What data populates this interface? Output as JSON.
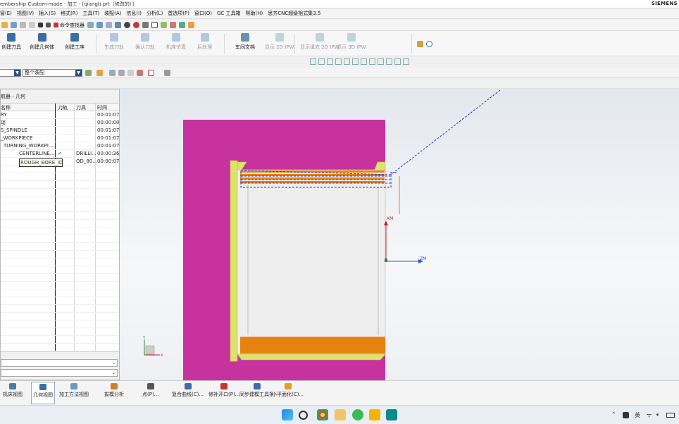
{
  "window": {
    "title": "embership Custom-made - 加工 - [qiangti.prt（修改的）]",
    "brand": "SIEMENS"
  },
  "menu": [
    "窗(E)",
    "视图(V)",
    "插入(S)",
    "格式(R)",
    "工具(T)",
    "装配(A)",
    "信息(I)",
    "分析(L)",
    "首选项(P)",
    "窗口(O)",
    "GC 工具箱",
    "帮助(H)",
    "思齐CNC超级祖式集3.5"
  ],
  "quickbar": {
    "command_finder": "命令查找器"
  },
  "ribbon": [
    {
      "label": "创建刀具",
      "enabled": true,
      "color": "#3a6ea5"
    },
    {
      "label": "创建几何体",
      "enabled": true,
      "color": "#3a6ea5"
    },
    {
      "label": "创建工序",
      "enabled": true,
      "color": "#3a6ea5"
    },
    {
      "label": "生成刀轨",
      "enabled": false,
      "color": "#5b8fc0"
    },
    {
      "label": "确认刀轨",
      "enabled": false,
      "color": "#5b8fc0"
    },
    {
      "label": "机床仿真",
      "enabled": false,
      "color": "#5b8fc0"
    },
    {
      "label": "后处理",
      "enabled": false,
      "color": "#5b8fc0"
    },
    {
      "label": "车间文档",
      "enabled": true,
      "color": "#6a8fb0"
    },
    {
      "label": "显示 2D IPW",
      "enabled": false,
      "color": "#7aa"
    },
    {
      "label": "显示填充 2D IPW",
      "enabled": false,
      "color": "#7aa"
    },
    {
      "label": "显示 3D IPW",
      "enabled": false,
      "color": "#7aa"
    }
  ],
  "selection": {
    "filter_value": "",
    "scope_value": "整个装配"
  },
  "navigator": {
    "title": "航器 - 几何",
    "columns": [
      "名称",
      "刀轨",
      "刀具",
      "时间"
    ],
    "rows": [
      {
        "name": "RY",
        "path": "",
        "tool": "",
        "time": "00:01:07"
      },
      {
        "name": "项",
        "path": "",
        "tool": "",
        "time": "00:00:00"
      },
      {
        "name": "S_SPINDLE",
        "path": "",
        "tool": "",
        "time": "00:01:07"
      },
      {
        "name": "_WORKPIECE",
        "path": "",
        "tool": "",
        "time": "00:01:07"
      },
      {
        "name": "TURNING_WORKPI...",
        "path": "",
        "tool": "",
        "time": "00:01:07"
      },
      {
        "name": "CENTERLINE...",
        "path": "✔",
        "tool": "DRILLI...",
        "time": "00:00:36"
      },
      {
        "name": "ROUGH_BORE_ID",
        "path": "",
        "tool": "OD_80...",
        "time": "00:00:07"
      }
    ],
    "selected_label": "ROUGH_BORE_ID"
  },
  "viewport": {
    "axis_x": "XM",
    "axis_z": "ZM",
    "triad_x": "X",
    "triad_y": "Y"
  },
  "bottombar": [
    {
      "label": "机床视图",
      "active": false
    },
    {
      "label": "几何视图",
      "active": true
    },
    {
      "label": "加工方法视图",
      "active": false
    },
    {
      "label": "拔模分析",
      "active": false
    },
    {
      "label": "点(P)...",
      "active": false
    },
    {
      "label": "复合曲线(C)...",
      "active": false
    },
    {
      "label": "修补开口(P)...",
      "active": false
    },
    {
      "label": "同步建模工具条",
      "active": false
    },
    {
      "label": "小平面化(C)...",
      "active": false
    }
  ],
  "tray": {
    "ime": "英"
  },
  "colors": {
    "stock": "#c8329e",
    "part": "#dde36a",
    "chip": "#e8820f",
    "toolpath": "#2233cc",
    "accent": "#2b4f8a"
  }
}
